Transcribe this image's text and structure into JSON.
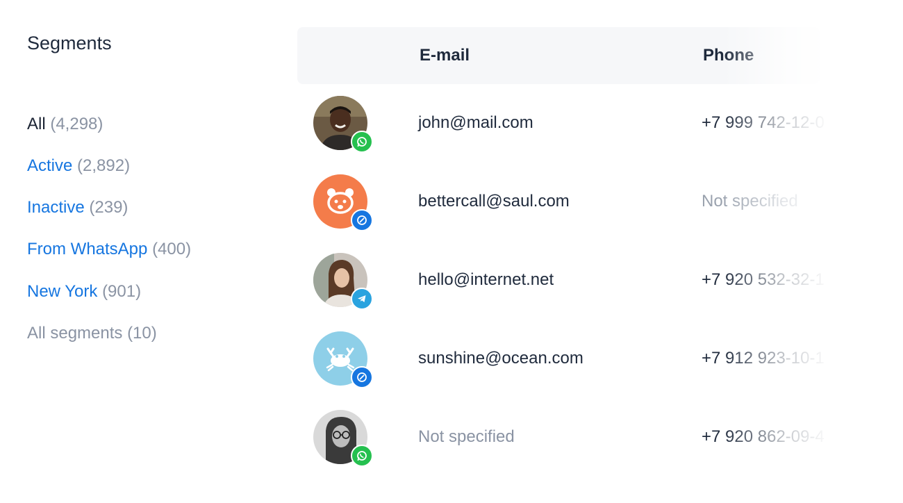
{
  "sidebar": {
    "title": "Segments",
    "segments": [
      {
        "name": "All",
        "count": "(4,298)"
      },
      {
        "name": "Active",
        "count": "(2,892)"
      },
      {
        "name": "Inactive",
        "count": "(239)"
      },
      {
        "name": "From WhatsApp",
        "count": "(400)"
      },
      {
        "name": "New York",
        "count": "(901)"
      },
      {
        "name": "All segments",
        "count": "(10)"
      }
    ]
  },
  "table": {
    "headers": {
      "email": "E-mail",
      "phone": "Phone"
    },
    "rows": [
      {
        "email": "john@mail.com",
        "phone": "+7 999 742-12-0",
        "channel": "whatsapp",
        "avatar": "man-photo"
      },
      {
        "email": "bettercall@saul.com",
        "phone": "Not specified",
        "channel": "chat",
        "avatar": "panda-icon"
      },
      {
        "email": "hello@internet.net",
        "phone": "+7 920 532-32-1",
        "channel": "telegram",
        "avatar": "woman-photo"
      },
      {
        "email": "sunshine@ocean.com",
        "phone": "+7 912 923-10-1",
        "channel": "chat",
        "avatar": "crab-icon"
      },
      {
        "email": "Not specified",
        "phone": "+7 920 862-09-4",
        "channel": "whatsapp",
        "avatar": "woman-glasses-photo"
      }
    ]
  },
  "colors": {
    "accent": "#1676e0",
    "muted": "#8a93a3",
    "whatsapp": "#25c04f",
    "telegram": "#2aa3df",
    "panda_bg": "#f47c4a",
    "crab_bg": "#8ecfe8"
  }
}
